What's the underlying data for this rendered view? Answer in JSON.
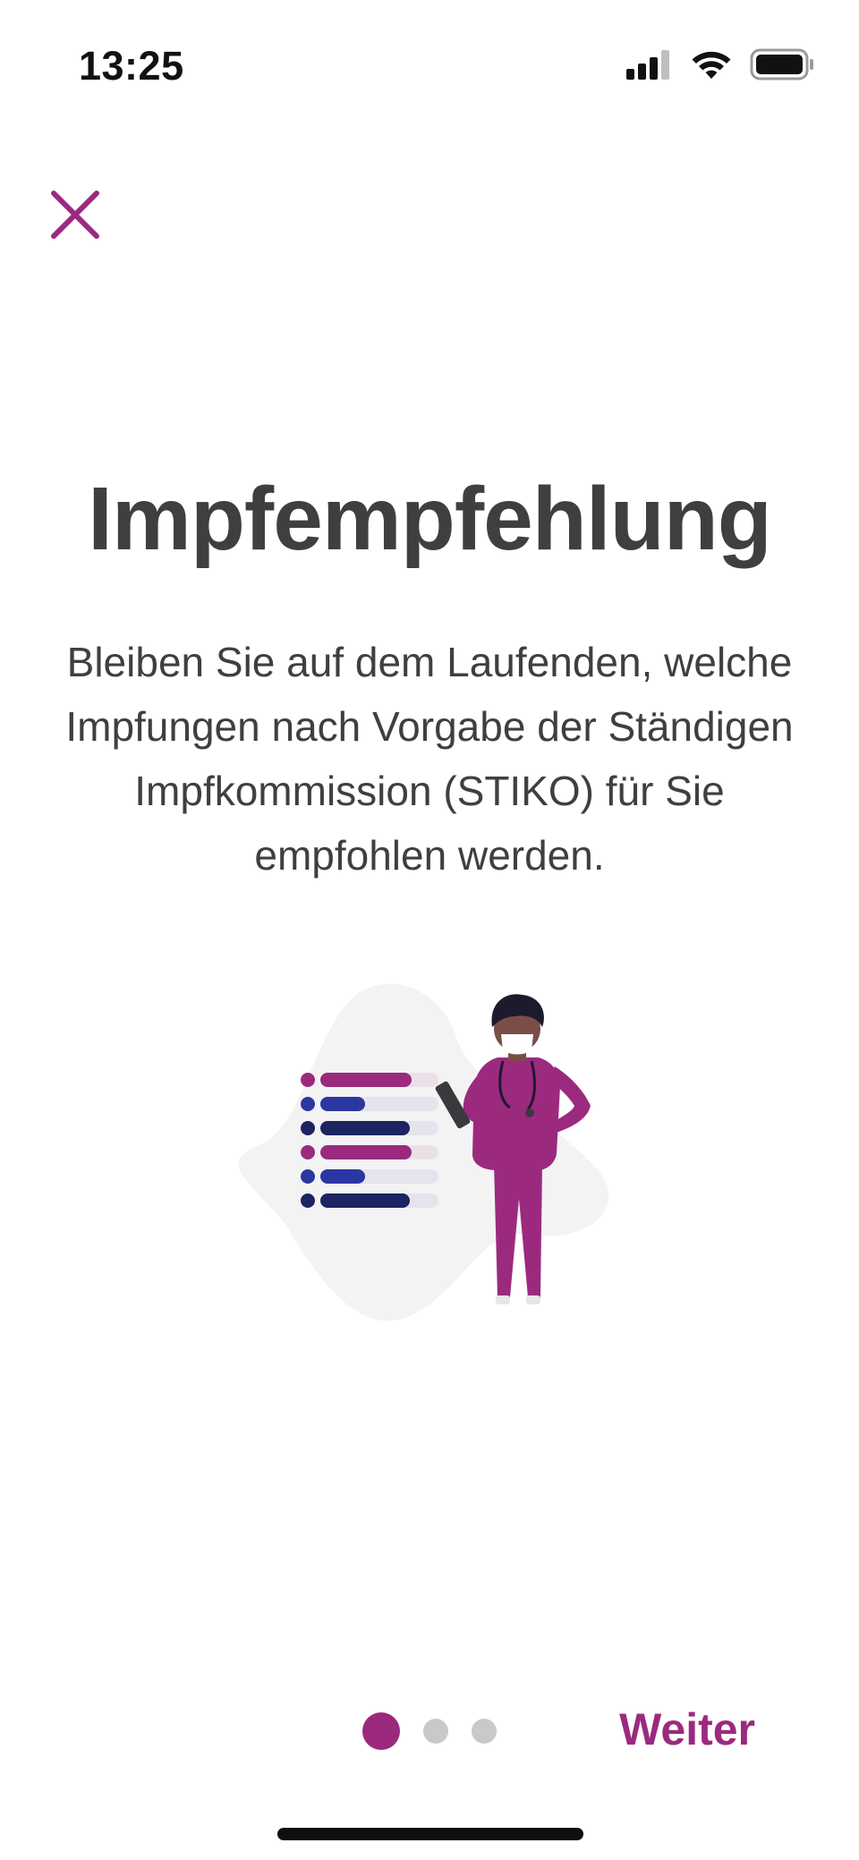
{
  "status_bar": {
    "time": "13:25",
    "icons": [
      "signal-icon",
      "wifi-icon",
      "battery-icon"
    ]
  },
  "header": {
    "close_icon": "close-icon"
  },
  "main": {
    "title": "Impfempfehlung",
    "description": "Bleiben Sie auf dem Laufenden, welche Impfungen nach Vorgabe der Ständigen Impfkommission (STIKO) für Sie empfohlen werden.",
    "illustration": "doctor-checklist-illustration"
  },
  "footer": {
    "pager": {
      "count": 3,
      "active_index": 0
    },
    "next_label": "Weiter"
  },
  "colors": {
    "accent": "#9b2a7f",
    "navy": "#1c2461",
    "blue": "#2b36a3",
    "text": "#3f3f42",
    "inactive_dot": "#c9c9cc"
  }
}
